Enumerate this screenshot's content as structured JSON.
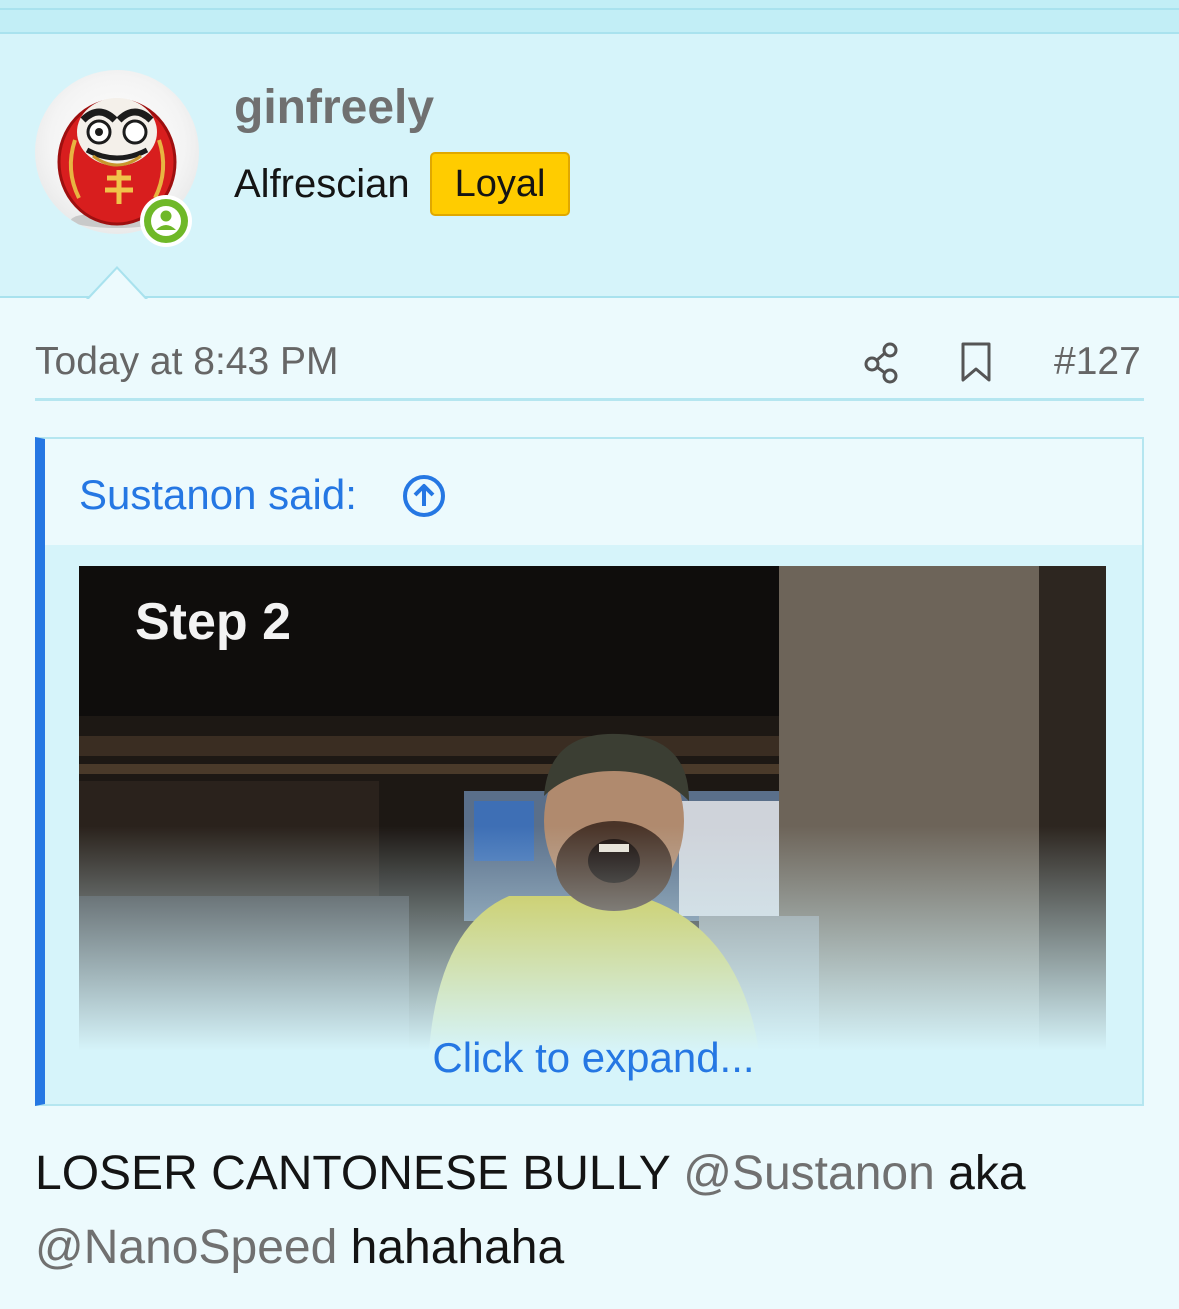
{
  "post": {
    "username": "ginfreely",
    "user_title": "Alfrescian",
    "user_banner": "Loyal",
    "timestamp": "Today at 8:43 PM",
    "post_number": "#127",
    "icons": {
      "share": "share-icon",
      "bookmark": "bookmark-icon",
      "online": "online-status-icon",
      "quote_jump": "arrow-up-circle-icon"
    }
  },
  "quote": {
    "author_said": "Sustanon said:",
    "media_caption": "Step 2",
    "expand_label": "Click to expand..."
  },
  "message": {
    "part1": "LOSER CANTONESE BULLY ",
    "mention1": "@Sustanon",
    "part2": " aka ",
    "mention2": "@NanoSpeed",
    "part3": " hahahaha"
  },
  "colors": {
    "background": "#ecfafd",
    "header_background": "#d6f4fa",
    "link": "#2577e3",
    "banner": "#ffcc00",
    "online": "#6fb828"
  }
}
